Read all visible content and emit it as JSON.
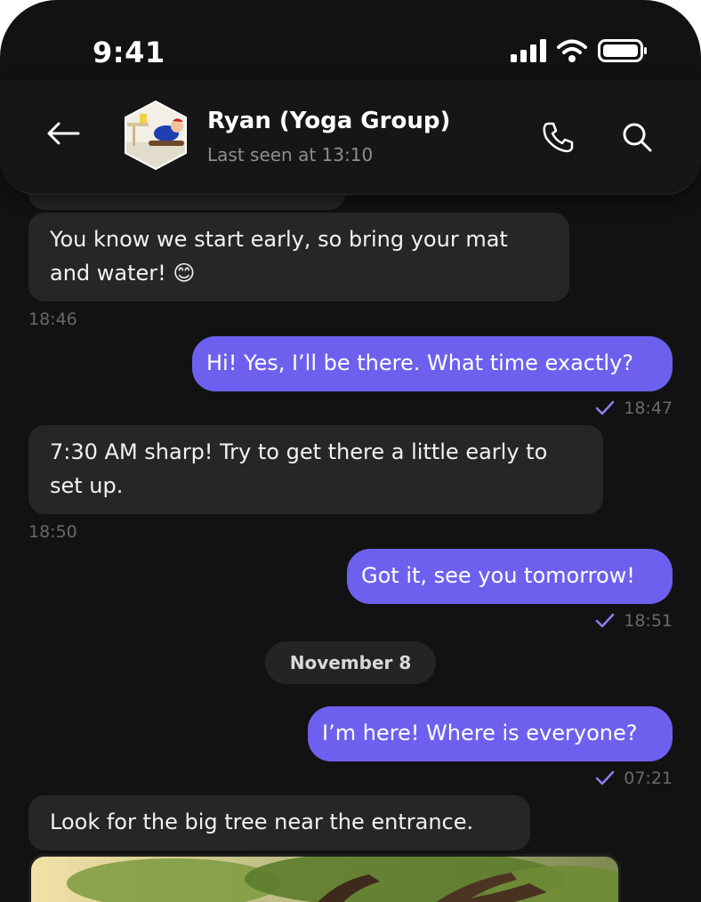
{
  "status_bar": {
    "time": "9:41"
  },
  "header": {
    "contact_name": "Ryan (Yoga Group)",
    "last_seen": "Last seen at 13:10"
  },
  "messages": [
    {
      "direction": "incoming",
      "text": "You know we start early, so bring your mat and water! 😊",
      "time": "18:46"
    },
    {
      "direction": "outgoing",
      "text": "Hi! Yes, I’ll be there. What time exactly?",
      "time": "18:47",
      "status": "sent"
    },
    {
      "direction": "incoming",
      "text": "7:30 AM sharp! Try to get there a little early to set up.",
      "time": "18:50"
    },
    {
      "direction": "outgoing",
      "text": "Got it, see you tomorrow!",
      "time": "18:51",
      "status": "sent"
    },
    {
      "direction": "outgoing",
      "text": "I’m here! Where is everyone?",
      "time": "07:21",
      "status": "sent"
    },
    {
      "direction": "incoming",
      "text": "Look for the big tree near the entrance."
    }
  ],
  "date_separator": "November 8",
  "colors": {
    "background": "#121212",
    "incoming_bubble": "#262626",
    "outgoing_bubble": "#6e60ee",
    "check": "#8b80f0"
  }
}
